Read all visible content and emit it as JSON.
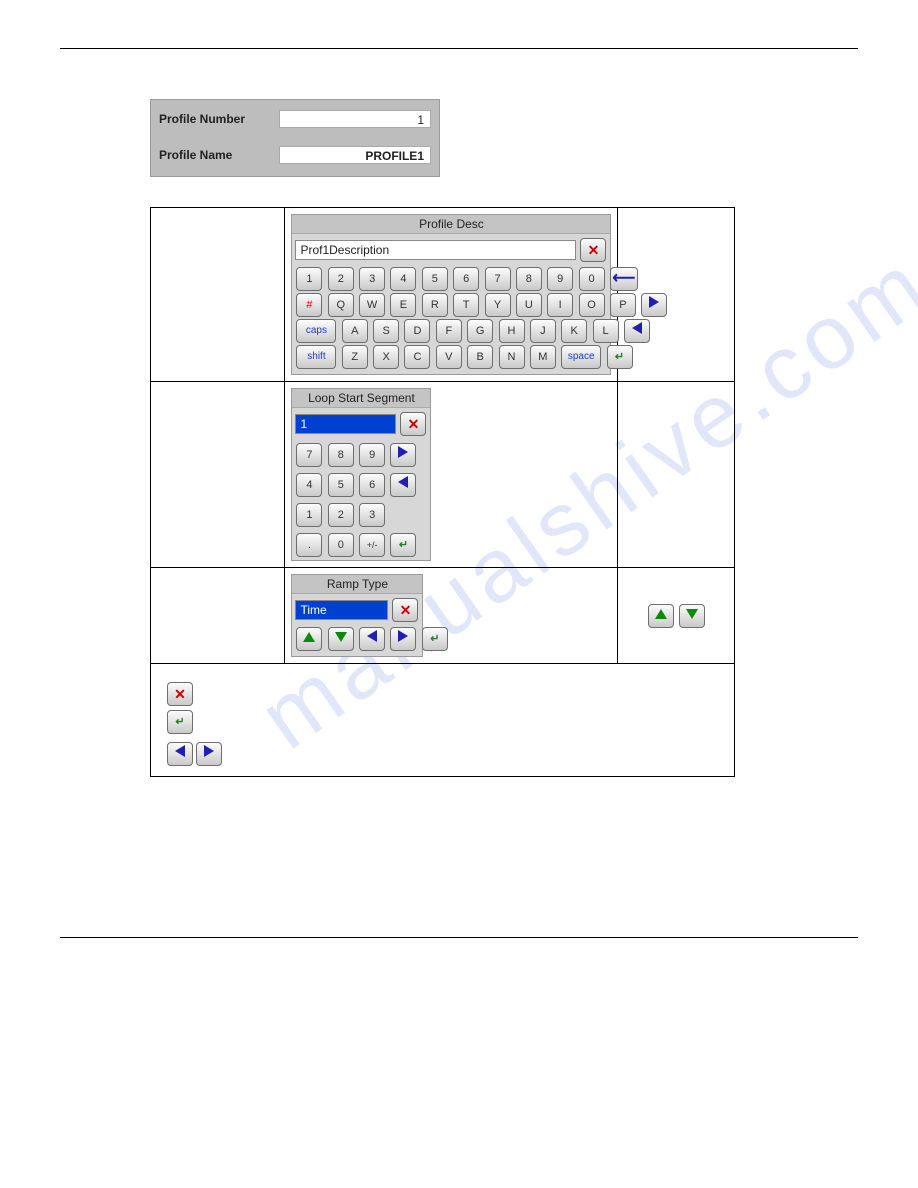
{
  "profile": {
    "num_label": "Profile Number",
    "num_value": "1",
    "name_label": "Profile Name",
    "name_value": "PROFILE1"
  },
  "alpha_pad": {
    "title": "Profile Desc",
    "value": "Prof1Description",
    "row1": [
      "1",
      "2",
      "3",
      "4",
      "5",
      "6",
      "7",
      "8",
      "9",
      "0"
    ],
    "row2": [
      "Q",
      "W",
      "E",
      "R",
      "T",
      "Y",
      "U",
      "I",
      "O",
      "P"
    ],
    "row3": [
      "A",
      "S",
      "D",
      "F",
      "G",
      "H",
      "J",
      "K",
      "L"
    ],
    "row4": [
      "Z",
      "X",
      "C",
      "V",
      "B",
      "N",
      "M"
    ],
    "hash": "#",
    "caps": "caps",
    "shift": "shift",
    "space": "space"
  },
  "num_pad": {
    "title": "Loop Start Segment",
    "value": "1",
    "r1": [
      "7",
      "8",
      "9"
    ],
    "r2": [
      "4",
      "5",
      "6"
    ],
    "r3": [
      "1",
      "2",
      "3"
    ],
    "r4": [
      ".",
      "0",
      "+/-"
    ]
  },
  "select_pad": {
    "title": "Ramp Type",
    "value": "Time"
  },
  "watermark": "manualshive.com"
}
